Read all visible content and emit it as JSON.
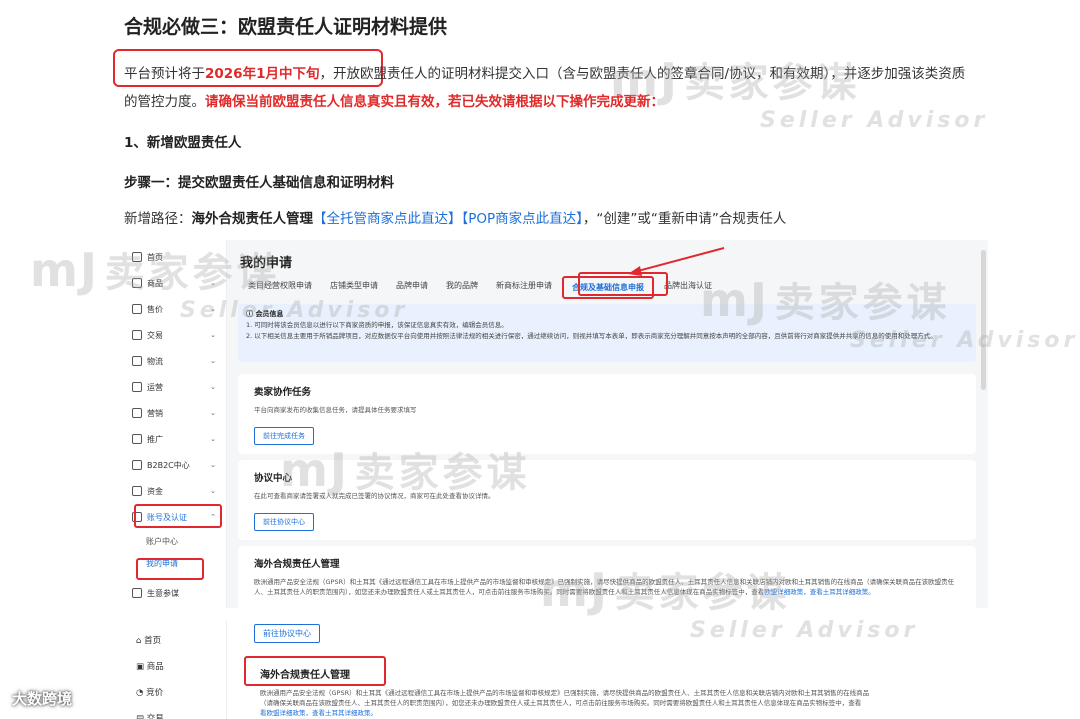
{
  "article": {
    "heading": "合规必做三：欧盟责任人证明材料提供",
    "para_prefix": "平台预计将于",
    "para_highlight": "2026年1月中下旬",
    "para_mid": "，开放欧盟责任人的证明材料提交入口（含与欧盟责任人的签章合同/协议，和有效期），并逐步加强该类资质的管控力度。",
    "para_red": "请确保当前欧盟责任人信息真实且有效，若已失效请根据以下操作完成更新：",
    "section1": "1、新增欧盟责任人",
    "step1": "步骤一：提交欧盟责任人基础信息和证明材料",
    "path_prefix": "新增路径：",
    "path_bold": "海外合规责任人管理",
    "path_link1": "【全托管商家点此直达】",
    "path_link2": "【POP商家点此直达】",
    "path_suffix": "，“创建”或“重新申请”合规责任人"
  },
  "screenshot1": {
    "sidebar": [
      {
        "label": "首页",
        "chevron": ""
      },
      {
        "label": "商品",
        "chevron": "⌄"
      },
      {
        "label": "售价",
        "chevron": "⌄"
      },
      {
        "label": "交易",
        "chevron": "⌄"
      },
      {
        "label": "物流",
        "chevron": "⌄"
      },
      {
        "label": "运营",
        "chevron": "⌄"
      },
      {
        "label": "营销",
        "chevron": "⌄"
      },
      {
        "label": "推广",
        "chevron": "⌄"
      },
      {
        "label": "B2B2C中心",
        "chevron": "⌄"
      },
      {
        "label": "资金",
        "chevron": "⌄"
      },
      {
        "label": "账号及认证",
        "chevron": "⌃"
      }
    ],
    "sidebar_sub": [
      "账户中心",
      "我的申请"
    ],
    "sidebar_last": "生意参谋",
    "page_title": "我的申请",
    "tabs": [
      "类目经营权限申请",
      "店铺类型申请",
      "品牌申请",
      "我的品牌",
      "新商标注册申请",
      "合规及基础信息申报",
      "品牌出海认证"
    ],
    "notice_title": "会员信息",
    "notice_line1": "1. 可同时将该会员信息以进行以下商家资质的申报，该保证信息真实有效，编辑会员信息。",
    "notice_line2": "2. 以下相关信息主要用于所销品牌项目，对应数据仅平台向使用并按照法律法规的相关进行保密，通过继续访问，则视并填写本表单，即表示商家充分理解并同意按本声明的全部内容，且供前将行对商家提供并共享的信息的使用和处理方式。",
    "card1_title": "卖家协作任务",
    "card1_desc": "平台向商家发布的收集信息任务，请提具体任务要求填写",
    "card1_btn": "前往完成任务",
    "card2_title": "协议中心",
    "card2_desc": "在此可查看商家请签署或人就完成已签署的协议情况，商家可在此处查看协议详情。",
    "card2_btn": "前往协议中心",
    "card3_title": "海外合规责任人管理",
    "card3_desc1": "欧洲通用产品安全法规（GPSR）和土耳其《通过远程通信工具在市场上提供产品的市场监督和审核规定》已强制实施，请尽快提供商品的欧盟责任人、土耳其责任人信息和关联店铺内对欧和土耳其销售的在线商品（请确保关联商品在该欧盟责任人、土耳其责任人的职责范围内），如您还未办理欧盟责任人或土耳其责任人，可点击前往服务市场购买。同时需要将欧盟责任人和土耳其责任人信息体现在商品实物标签中，查看",
    "card3_desc2": "欧盟详细政策，查看土耳其详细政策。"
  },
  "screenshot2": {
    "btn": "前往协议中心",
    "sidebar": [
      "首页",
      "商品",
      "竞价",
      "交易"
    ],
    "card_title": "海外合规责任人管理",
    "desc1": "欧洲通用产品安全法规（GPSR）和土耳其《通过远程通信工具在市场上提供产品的市场监督和审核规定》已强制实施，请尽快提供商品的欧盟责任人、土耳其责任人信息和关联店铺内对欧和土耳其销售的在线商品",
    "desc2": "（请确保关联商品在该欧盟责任人、土耳其责任人的职责范围内），如您还未办理欧盟责任人或土耳其责任人，可点击前往服务市场购买。同时需要将欧盟责任人和土耳其责任人信息体现在商品实物标签中，查看",
    "desc3": "看欧盟详细政策，查看土耳其详细政策。"
  },
  "watermark": {
    "logo": "mJ",
    "cn": "卖家参谋",
    "en": "Seller Advisor"
  },
  "footer": "大数跨境"
}
